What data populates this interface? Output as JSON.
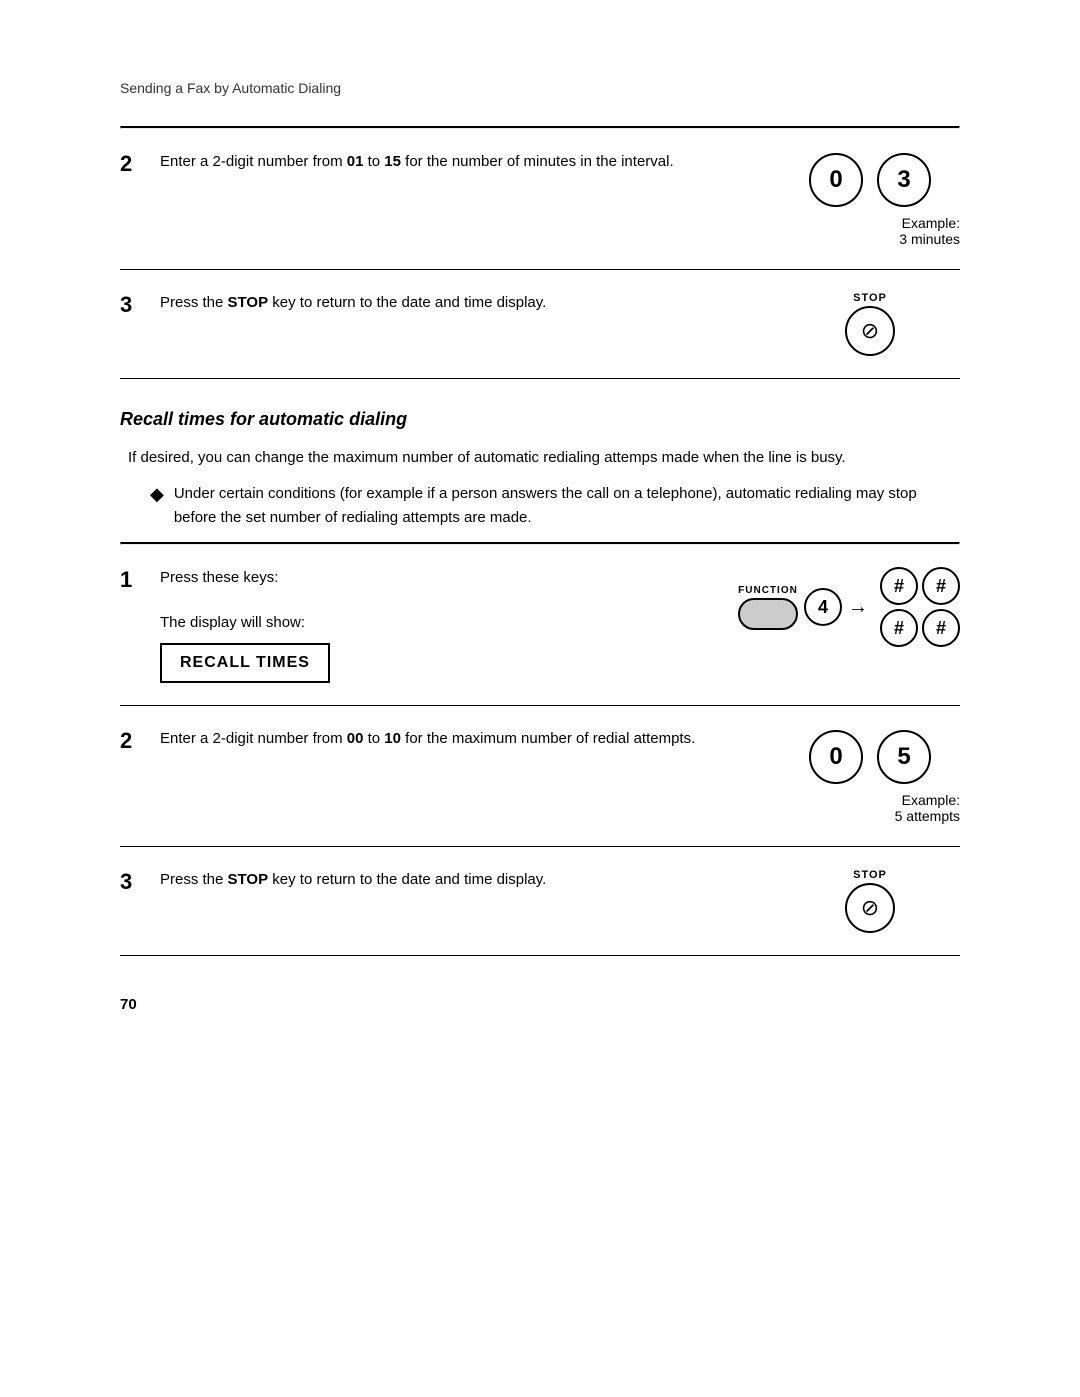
{
  "breadcrumb": "Sending a Fax by Automatic Dialing",
  "section1": {
    "step2": {
      "number": "2",
      "text_prefix": "Enter a 2-digit number from ",
      "bold1": "01",
      "text_mid": " to ",
      "bold2": "15",
      "text_suffix": " for the number of minutes in the interval.",
      "key1": "0",
      "key2": "3",
      "example_line1": "Example:",
      "example_line2": "3 minutes"
    },
    "step3": {
      "number": "3",
      "text_prefix": "Press the ",
      "bold1": "STOP",
      "text_suffix": " key to return to the date and time display.",
      "stop_label": "STOP"
    }
  },
  "recall_section": {
    "heading": "Recall times for automatic dialing",
    "body": "If desired, you can change the maximum number of automatic redialing attemps made when the line is busy.",
    "bullet": "Under certain conditions (for example if a person answers the call on a telephone), automatic redialing may stop before the set number of redialing attempts are made.",
    "step1": {
      "number": "1",
      "text1": "Press these keys:",
      "text2": "The display will show:",
      "function_label": "FUNCTION",
      "num4": "4",
      "display_text": "RECALL TIMES"
    },
    "step2": {
      "number": "2",
      "text_prefix": "Enter a 2-digit number from ",
      "bold1": "00",
      "text_mid": " to ",
      "bold2": "10",
      "text_suffix": " for the maximum number of redial attempts.",
      "key1": "0",
      "key2": "5",
      "example_line1": "Example:",
      "example_line2": "5 attempts"
    },
    "step3": {
      "number": "3",
      "text_prefix": "Press the ",
      "bold1": "STOP",
      "text_suffix": " key to return to the date and time display.",
      "stop_label": "STOP"
    }
  },
  "page_number": "70"
}
